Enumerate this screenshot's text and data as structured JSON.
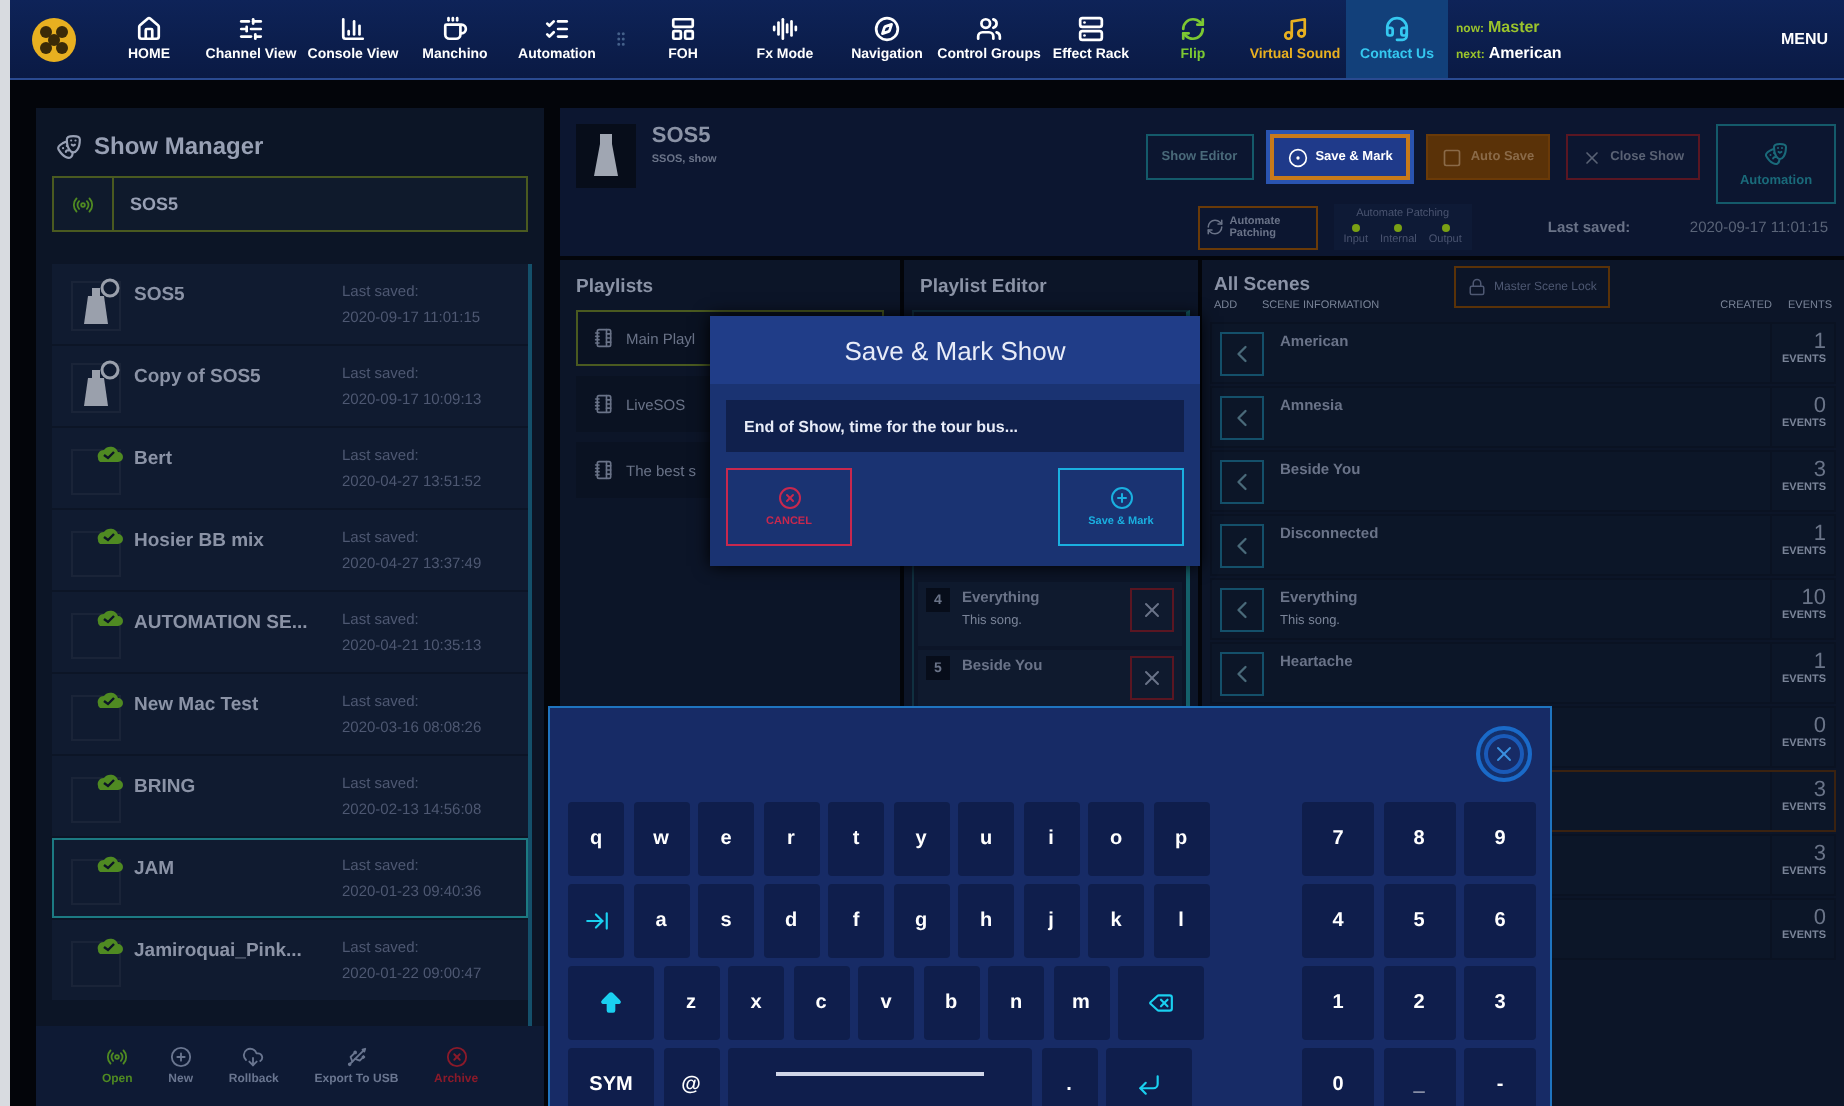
{
  "top_bar": {
    "nav": [
      {
        "label": "HOME",
        "color": "#ffffff",
        "selected": false
      },
      {
        "label": "Channel View",
        "color": "#ffffff",
        "selected": false
      },
      {
        "label": "Console View",
        "color": "#ffffff",
        "selected": false
      },
      {
        "label": "Manchino",
        "color": "#ffffff",
        "selected": false
      },
      {
        "label": "Automation",
        "color": "#ffffff",
        "selected": false
      },
      {
        "label": "FOH",
        "color": "#ffffff",
        "selected": false
      },
      {
        "label": "Fx Mode",
        "color": "#ffffff",
        "selected": false
      },
      {
        "label": "Navigation",
        "color": "#ffffff",
        "selected": false
      },
      {
        "label": "Control Groups",
        "color": "#ffffff",
        "selected": false
      },
      {
        "label": "Effect Rack",
        "color": "#ffffff",
        "selected": false
      },
      {
        "label": "Flip",
        "color": "#7cc832",
        "selected": false
      },
      {
        "label": "Virtual Sound",
        "color": "#e8b020",
        "selected": false
      },
      {
        "label": "Contact Us",
        "color": "#35c8f0",
        "selected": true
      }
    ],
    "cue": {
      "now_label": "now:",
      "now": "Master",
      "next_label": "next:",
      "next": "American"
    },
    "menu": "MENU"
  },
  "show_manager": {
    "title": "Show Manager",
    "current_show": "SOS5",
    "shows": [
      {
        "name": "SOS5",
        "kind": "local",
        "saved_label": "Last saved:",
        "saved_at": "2020-09-17 11:01:15",
        "selected": false
      },
      {
        "name": "Copy of SOS5",
        "kind": "local",
        "saved_label": "Last saved:",
        "saved_at": "2020-09-17 10:09:13",
        "selected": false
      },
      {
        "name": "Bert",
        "kind": "cloud",
        "saved_label": "Last saved:",
        "saved_at": "2020-04-27 13:51:52",
        "selected": false
      },
      {
        "name": "Hosier BB mix",
        "kind": "cloud",
        "saved_label": "Last saved:",
        "saved_at": "2020-04-27 13:37:49",
        "selected": false
      },
      {
        "name": "AUTOMATION SE...",
        "kind": "cloud",
        "saved_label": "Last saved:",
        "saved_at": "2020-04-21 10:35:13",
        "selected": false
      },
      {
        "name": "New Mac Test",
        "kind": "cloud",
        "saved_label": "Last saved:",
        "saved_at": "2020-03-16 08:08:26",
        "selected": false
      },
      {
        "name": "BRING",
        "kind": "cloud",
        "saved_label": "Last saved:",
        "saved_at": "2020-02-13 14:56:08",
        "selected": false
      },
      {
        "name": "JAM",
        "kind": "cloud",
        "saved_label": "Last saved:",
        "saved_at": "2020-01-23 09:40:36",
        "selected": true
      },
      {
        "name": "Jamiroquai_Pink...",
        "kind": "cloud",
        "saved_label": "Last saved:",
        "saved_at": "2020-01-22 09:00:47",
        "selected": false
      }
    ],
    "toolbar": [
      {
        "label": "Open",
        "kind": "open",
        "color": "#4f8a22"
      },
      {
        "label": "New",
        "kind": "new",
        "color": "#6a7690"
      },
      {
        "label": "Rollback",
        "kind": "rollback",
        "color": "#6a7690"
      },
      {
        "label": "Export To USB",
        "kind": "export",
        "color": "#6a7690"
      },
      {
        "label": "Archive",
        "kind": "archive",
        "color": "#8a1a2a"
      }
    ]
  },
  "show": {
    "name": "SOS5",
    "subtitle": "SSOS, show",
    "buttons": [
      {
        "label": "Show Editor",
        "kind": "outline"
      },
      {
        "label": "Save & Mark",
        "kind": "active"
      },
      {
        "label": "Auto Save",
        "kind": "warning"
      },
      {
        "label": "Close Show",
        "kind": "danger"
      }
    ],
    "automation": "Automation",
    "automate_button": "Automate Patching",
    "patching": {
      "title": "Automate Patching",
      "channels": [
        {
          "label": "Input",
          "on": true
        },
        {
          "label": "Internal",
          "on": true
        },
        {
          "label": "Output",
          "on": true
        }
      ]
    },
    "last_saved_label": "Last saved:",
    "last_saved": "2020-09-17 11:01:15"
  },
  "playlists": {
    "title": "Playlists",
    "items": [
      {
        "name": "Main Playl",
        "selected": true
      },
      {
        "name": "LiveSOS",
        "selected": false
      },
      {
        "name": "The best s",
        "selected": false
      }
    ]
  },
  "playlist_editor": {
    "title": "Playlist Editor",
    "items": [
      {
        "number": "4",
        "name": "Everything",
        "note": "This song."
      },
      {
        "number": "5",
        "name": "Beside You"
      }
    ]
  },
  "scenes": {
    "title": "All Scenes",
    "lock": "Master Scene Lock",
    "columns": [
      "ADD",
      "SCENE INFORMATION",
      "CREATED",
      "EVENTS"
    ],
    "rows": [
      {
        "name": "American",
        "events": "1",
        "unit": "EVENTS",
        "selected": false
      },
      {
        "name": "Amnesia",
        "events": "0",
        "unit": "EVENTS",
        "selected": false
      },
      {
        "name": "Beside You",
        "events": "3",
        "unit": "EVENTS",
        "selected": false
      },
      {
        "name": "Disconnected",
        "events": "1",
        "unit": "EVENTS",
        "selected": false
      },
      {
        "name": "Everything",
        "note": "This song.",
        "events": "10",
        "unit": "EVENTS",
        "selected": false
      },
      {
        "name": "Heartache",
        "events": "1",
        "unit": "EVENTS",
        "selected": false
      },
      {
        "events": "0",
        "unit": "EVENTS",
        "selected": false
      },
      {
        "events": "3",
        "unit": "EVENTS",
        "selected": true
      },
      {
        "events": "3",
        "unit": "EVENTS",
        "selected": false
      },
      {
        "events": "0",
        "unit": "EVENTS",
        "selected": false
      }
    ]
  },
  "dialog": {
    "title": "Save & Mark Show",
    "value": "End of Show, time for the tour bus...",
    "cancel": "CANCEL",
    "confirm": "Save & Mark"
  },
  "keyboard": {
    "rows": [
      [
        {
          "kind": "char",
          "label": "q"
        },
        {
          "kind": "char",
          "label": "w"
        },
        {
          "kind": "char",
          "label": "e"
        },
        {
          "kind": "char",
          "label": "r"
        },
        {
          "kind": "char",
          "label": "t"
        },
        {
          "kind": "char",
          "label": "y"
        },
        {
          "kind": "char",
          "label": "u"
        },
        {
          "kind": "char",
          "label": "i"
        },
        {
          "kind": "char",
          "label": "o"
        },
        {
          "kind": "char",
          "label": "p"
        }
      ],
      [
        {
          "kind": "tab"
        },
        {
          "kind": "char",
          "label": "a"
        },
        {
          "kind": "char",
          "label": "s"
        },
        {
          "kind": "char",
          "label": "d"
        },
        {
          "kind": "char",
          "label": "f"
        },
        {
          "kind": "char",
          "label": "g"
        },
        {
          "kind": "char",
          "label": "h"
        },
        {
          "kind": "char",
          "label": "j"
        },
        {
          "kind": "char",
          "label": "k"
        },
        {
          "kind": "char",
          "label": "l"
        }
      ],
      [
        {
          "kind": "shift"
        },
        {
          "kind": "char",
          "label": "z"
        },
        {
          "kind": "char",
          "label": "x"
        },
        {
          "kind": "char",
          "label": "c"
        },
        {
          "kind": "char",
          "label": "v"
        },
        {
          "kind": "char",
          "label": "b"
        },
        {
          "kind": "char",
          "label": "n"
        },
        {
          "kind": "char",
          "label": "m"
        },
        {
          "kind": "backspace"
        }
      ],
      [
        {
          "kind": "wide",
          "label": "SYM"
        },
        {
          "kind": "char",
          "label": "@"
        },
        {
          "kind": "space"
        },
        {
          "kind": "char",
          "label": "."
        },
        {
          "kind": "enter"
        }
      ]
    ],
    "numpad": [
      [
        "7",
        "8",
        "9"
      ],
      [
        "4",
        "5",
        "6"
      ],
      [
        "1",
        "2",
        "3"
      ],
      [
        "0",
        "_",
        "-"
      ]
    ]
  }
}
